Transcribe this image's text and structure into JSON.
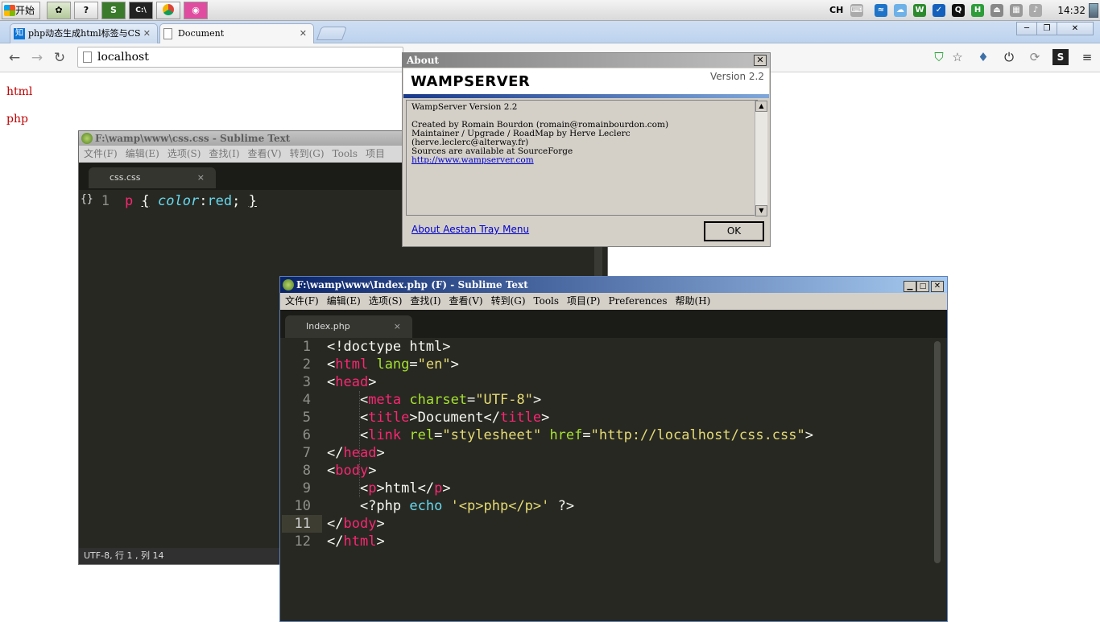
{
  "taskbar": {
    "start_label": "开始",
    "ime": "CH",
    "clock": "14:32"
  },
  "browser": {
    "tabs": [
      {
        "title": "php动态生成html标签与CS"
      },
      {
        "title": "Document"
      }
    ],
    "url": "localhost"
  },
  "page": {
    "paragraphs": [
      "html",
      "php"
    ]
  },
  "css_window": {
    "title": "F:\\wamp\\www\\css.css - Sublime Text",
    "menu": [
      "文件(F)",
      "编辑(E)",
      "选项(S)",
      "查找(I)",
      "查看(V)",
      "转到(G)",
      "Tools",
      "项目"
    ],
    "tab": "css.css",
    "line_number": "1",
    "status": "UTF-8, 行 1 , 列 14"
  },
  "php_window": {
    "title": "F:\\wamp\\www\\Index.php (F) - Sublime Text",
    "menu": [
      "文件(F)",
      "编辑(E)",
      "选项(S)",
      "查找(I)",
      "查看(V)",
      "转到(G)",
      "Tools",
      "项目(P)",
      "Preferences",
      "帮助(H)"
    ],
    "tab": "Index.php",
    "line_numbers": [
      "1",
      "2",
      "3",
      "4",
      "5",
      "6",
      "7",
      "8",
      "9",
      "10",
      "11",
      "12"
    ]
  },
  "about": {
    "title": "About",
    "product": "WAMPSERVER",
    "version": "Version 2.2",
    "body": "WampServer Version 2.2\n\nCreated by Romain Bourdon (romain@romainbourdon.com)\nMaintainer / Upgrade / RoadMap by Herve Leclerc\n(herve.leclerc@alterway.fr)\nSources are available at SourceForge",
    "site_link": "http://www.wampserver.com",
    "tray_link": "About Aestan Tray Menu",
    "ok_label": "OK"
  }
}
